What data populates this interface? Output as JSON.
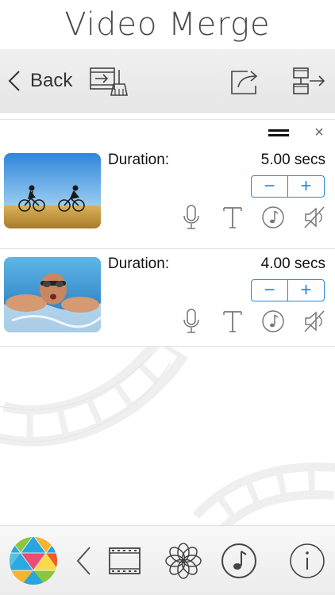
{
  "header": {
    "title": "Video Merge"
  },
  "toolbar": {
    "back_label": "Back",
    "icons": [
      "chevron-left-icon",
      "clear-clips-icon",
      "share-icon",
      "export-merge-icon"
    ]
  },
  "clips": [
    {
      "thumbnail": "cyclists-thumbnail",
      "duration_label": "Duration:",
      "duration_value": "5.00 secs",
      "minus": "−",
      "plus": "+"
    },
    {
      "thumbnail": "swimmer-thumbnail",
      "duration_label": "Duration:",
      "duration_value": "4.00 secs",
      "minus": "−",
      "plus": "+"
    }
  ],
  "clip_tools": [
    "microphone-icon",
    "text-icon",
    "music-note-icon",
    "mute-icon"
  ],
  "bottom_bar": {
    "icons": [
      "app-logo-icon",
      "chevron-left-icon",
      "film-strip-icon",
      "aperture-flower-icon",
      "music-circle-icon",
      "info-icon"
    ]
  },
  "colors": {
    "accent": "#2e87d6",
    "toolbar_bg": "#eaeaea",
    "title_text": "#4a4a4a"
  }
}
